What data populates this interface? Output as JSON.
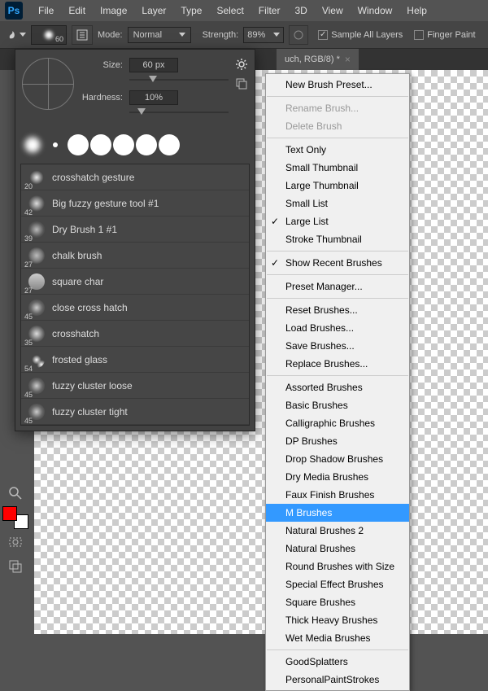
{
  "menubar": [
    "File",
    "Edit",
    "Image",
    "Layer",
    "Type",
    "Select",
    "Filter",
    "3D",
    "View",
    "Window",
    "Help"
  ],
  "optbar": {
    "brush_size": "60",
    "mode_label": "Mode:",
    "mode_value": "Normal",
    "strength_label": "Strength:",
    "strength_value": "89%",
    "sample_all": "Sample All Layers",
    "finger_paint": "Finger Paint"
  },
  "tab": {
    "title": "uch, RGB/8) *"
  },
  "brush_panel": {
    "size_label": "Size:",
    "size_value": "60 px",
    "hardness_label": "Hardness:",
    "hardness_value": "10%",
    "list": [
      {
        "size": "20",
        "name": "crosshatch gesture",
        "style": "radial-gradient(#eee,transparent 60%)"
      },
      {
        "size": "42",
        "name": "Big fuzzy gesture tool #1",
        "style": "radial-gradient(#ddd,transparent 70%)"
      },
      {
        "size": "39",
        "name": "Dry Brush 1 #1",
        "style": "radial-gradient(#bbb,#555 60%,transparent 80%)"
      },
      {
        "size": "27",
        "name": "chalk brush",
        "style": "radial-gradient(#bbb,#777 50%,transparent 75%)"
      },
      {
        "size": "27",
        "name": "square char",
        "style": "linear-gradient(#ccc,#888)"
      },
      {
        "size": "45",
        "name": "close cross hatch",
        "style": "radial-gradient(#ccc,#666 50%,transparent 80%)"
      },
      {
        "size": "35",
        "name": "crosshatch",
        "style": "radial-gradient(#ddd,#777 50%,transparent 75%)"
      },
      {
        "size": "54",
        "name": "frosted glass",
        "style": "radial-gradient(#fff,transparent 40%),radial-gradient(#fff,transparent 40%) 6px 6px"
      },
      {
        "size": "45",
        "name": "fuzzy cluster loose",
        "style": "radial-gradient(#ccc,#666 50%,transparent 80%)"
      },
      {
        "size": "45",
        "name": "fuzzy cluster tight",
        "style": "radial-gradient(#ccc,#666 50%,transparent 80%)"
      }
    ]
  },
  "ctx": {
    "groups": [
      [
        {
          "t": "New Brush Preset..."
        }
      ],
      [
        {
          "t": "Rename Brush...",
          "d": true
        },
        {
          "t": "Delete Brush",
          "d": true
        }
      ],
      [
        {
          "t": "Text Only"
        },
        {
          "t": "Small Thumbnail"
        },
        {
          "t": "Large Thumbnail"
        },
        {
          "t": "Small List"
        },
        {
          "t": "Large List",
          "c": true
        },
        {
          "t": "Stroke Thumbnail"
        }
      ],
      [
        {
          "t": "Show Recent Brushes",
          "c": true
        }
      ],
      [
        {
          "t": "Preset Manager..."
        }
      ],
      [
        {
          "t": "Reset Brushes..."
        },
        {
          "t": "Load Brushes..."
        },
        {
          "t": "Save Brushes..."
        },
        {
          "t": "Replace Brushes..."
        }
      ],
      [
        {
          "t": "Assorted Brushes"
        },
        {
          "t": "Basic Brushes"
        },
        {
          "t": "Calligraphic Brushes"
        },
        {
          "t": "DP Brushes"
        },
        {
          "t": "Drop Shadow Brushes"
        },
        {
          "t": "Dry Media Brushes"
        },
        {
          "t": "Faux Finish Brushes"
        },
        {
          "t": "M Brushes",
          "s": true
        },
        {
          "t": "Natural Brushes 2"
        },
        {
          "t": "Natural Brushes"
        },
        {
          "t": "Round Brushes with Size"
        },
        {
          "t": "Special Effect Brushes"
        },
        {
          "t": "Square Brushes"
        },
        {
          "t": "Thick Heavy Brushes"
        },
        {
          "t": "Wet Media Brushes"
        }
      ],
      [
        {
          "t": "GoodSplatters"
        },
        {
          "t": "PersonalPaintStrokes"
        }
      ]
    ]
  }
}
